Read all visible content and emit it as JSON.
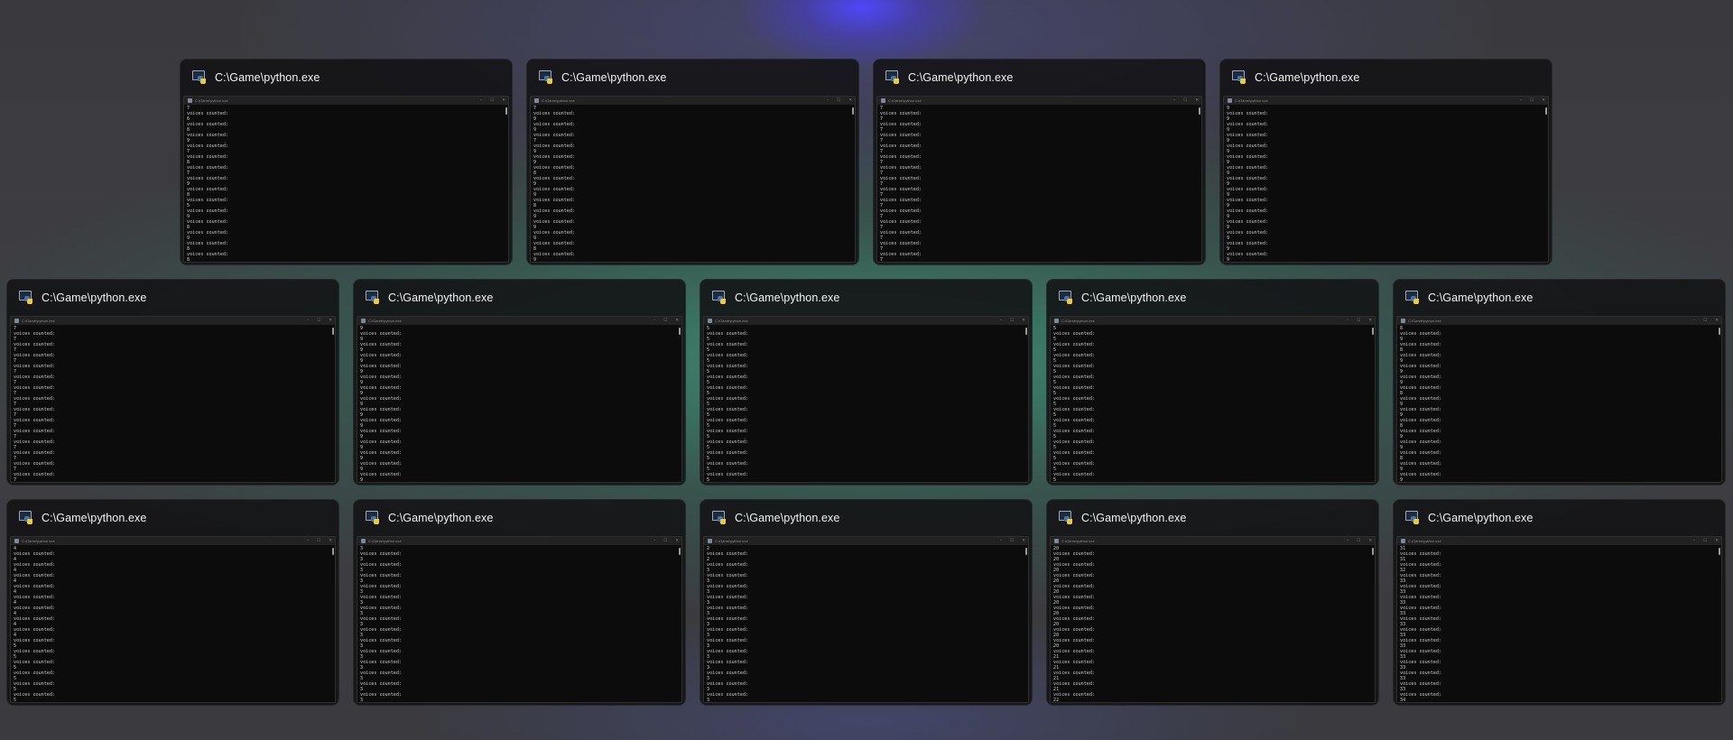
{
  "title": "C:\\Game\\python.exe",
  "inner_title": "C:\\Game\\python.exe",
  "line_label": "voices counted:",
  "window_controls": [
    "–",
    "☐",
    "✕"
  ],
  "rows": [
    [
      {
        "title": "C:\\Game\\python.exe",
        "first": "7",
        "counts": [
          "6",
          "8",
          "9",
          "7",
          "8",
          "7",
          "9",
          "8",
          "5",
          "9",
          "8",
          "9",
          "8",
          "8"
        ]
      },
      {
        "title": "C:\\Game\\python.exe",
        "first": "7",
        "counts": [
          "9",
          "9",
          "7",
          "9",
          "9",
          "8",
          "9",
          "9",
          "8",
          "9",
          "9",
          "9",
          "8",
          "9"
        ]
      },
      {
        "title": "C:\\Game\\python.exe",
        "first": "7",
        "counts": [
          "7",
          "7",
          "7",
          "7",
          "7",
          "7",
          "7",
          "7",
          "7",
          "7",
          "7",
          "7",
          "7",
          "7"
        ]
      },
      {
        "title": "C:\\Game\\python.exe",
        "first": "9",
        "counts": [
          "9",
          "9",
          "9",
          "9",
          "9",
          "9",
          "9",
          "9",
          "9",
          "9",
          "9",
          "9",
          "9",
          "9"
        ]
      }
    ],
    [
      {
        "title": "C:\\Game\\python.exe",
        "first": "7",
        "counts": [
          "7",
          "7",
          "7",
          "7",
          "7",
          "7",
          "7",
          "7",
          "7",
          "7",
          "7",
          "7",
          "7",
          "7"
        ]
      },
      {
        "title": "C:\\Game\\python.exe",
        "first": "9",
        "counts": [
          "9",
          "9",
          "9",
          "9",
          "9",
          "9",
          "9",
          "9",
          "9",
          "9",
          "9",
          "9",
          "9",
          "9"
        ]
      },
      {
        "title": "C:\\Game\\python.exe",
        "first": "5",
        "counts": [
          "5",
          "5",
          "5",
          "5",
          "5",
          "5",
          "5",
          "5",
          "5",
          "5",
          "5",
          "5",
          "5",
          "5"
        ]
      },
      {
        "title": "C:\\Game\\python.exe",
        "first": "5",
        "counts": [
          "5",
          "5",
          "5",
          "5",
          "5",
          "5",
          "5",
          "5",
          "5",
          "5",
          "5",
          "5",
          "5",
          "5"
        ]
      },
      {
        "title": "C:\\Game\\python.exe",
        "first": "8",
        "counts": [
          "9",
          "8",
          "9",
          "9",
          "9",
          "8",
          "9",
          "9",
          "8",
          "9",
          "9",
          "8",
          "9",
          "9"
        ]
      }
    ],
    [
      {
        "title": "C:\\Game\\python.exe",
        "first": "4",
        "counts": [
          "4",
          "4",
          "4",
          "4",
          "4",
          "4",
          "4",
          "4",
          "5",
          "5",
          "5",
          "5",
          "5",
          "5"
        ]
      },
      {
        "title": "C:\\Game\\python.exe",
        "first": "3",
        "counts": [
          "3",
          "3",
          "3",
          "3",
          "3",
          "3",
          "3",
          "3",
          "3",
          "3",
          "3",
          "3",
          "3",
          "3"
        ]
      },
      {
        "title": "C:\\Game\\python.exe",
        "first": "2",
        "counts": [
          "2",
          "3",
          "3",
          "3",
          "3",
          "3",
          "3",
          "3",
          "3",
          "3",
          "3",
          "3",
          "3",
          "3"
        ]
      },
      {
        "title": "C:\\Game\\python.exe",
        "first": "20",
        "counts": [
          "20",
          "20",
          "20",
          "20",
          "20",
          "20",
          "20",
          "20",
          "20",
          "21",
          "21",
          "21",
          "21",
          "22"
        ]
      },
      {
        "title": "C:\\Game\\python.exe",
        "first": "31",
        "counts": [
          "31",
          "32",
          "33",
          "33",
          "33",
          "33",
          "33",
          "33",
          "33",
          "33",
          "33",
          "33",
          "33",
          "34"
        ]
      }
    ]
  ]
}
